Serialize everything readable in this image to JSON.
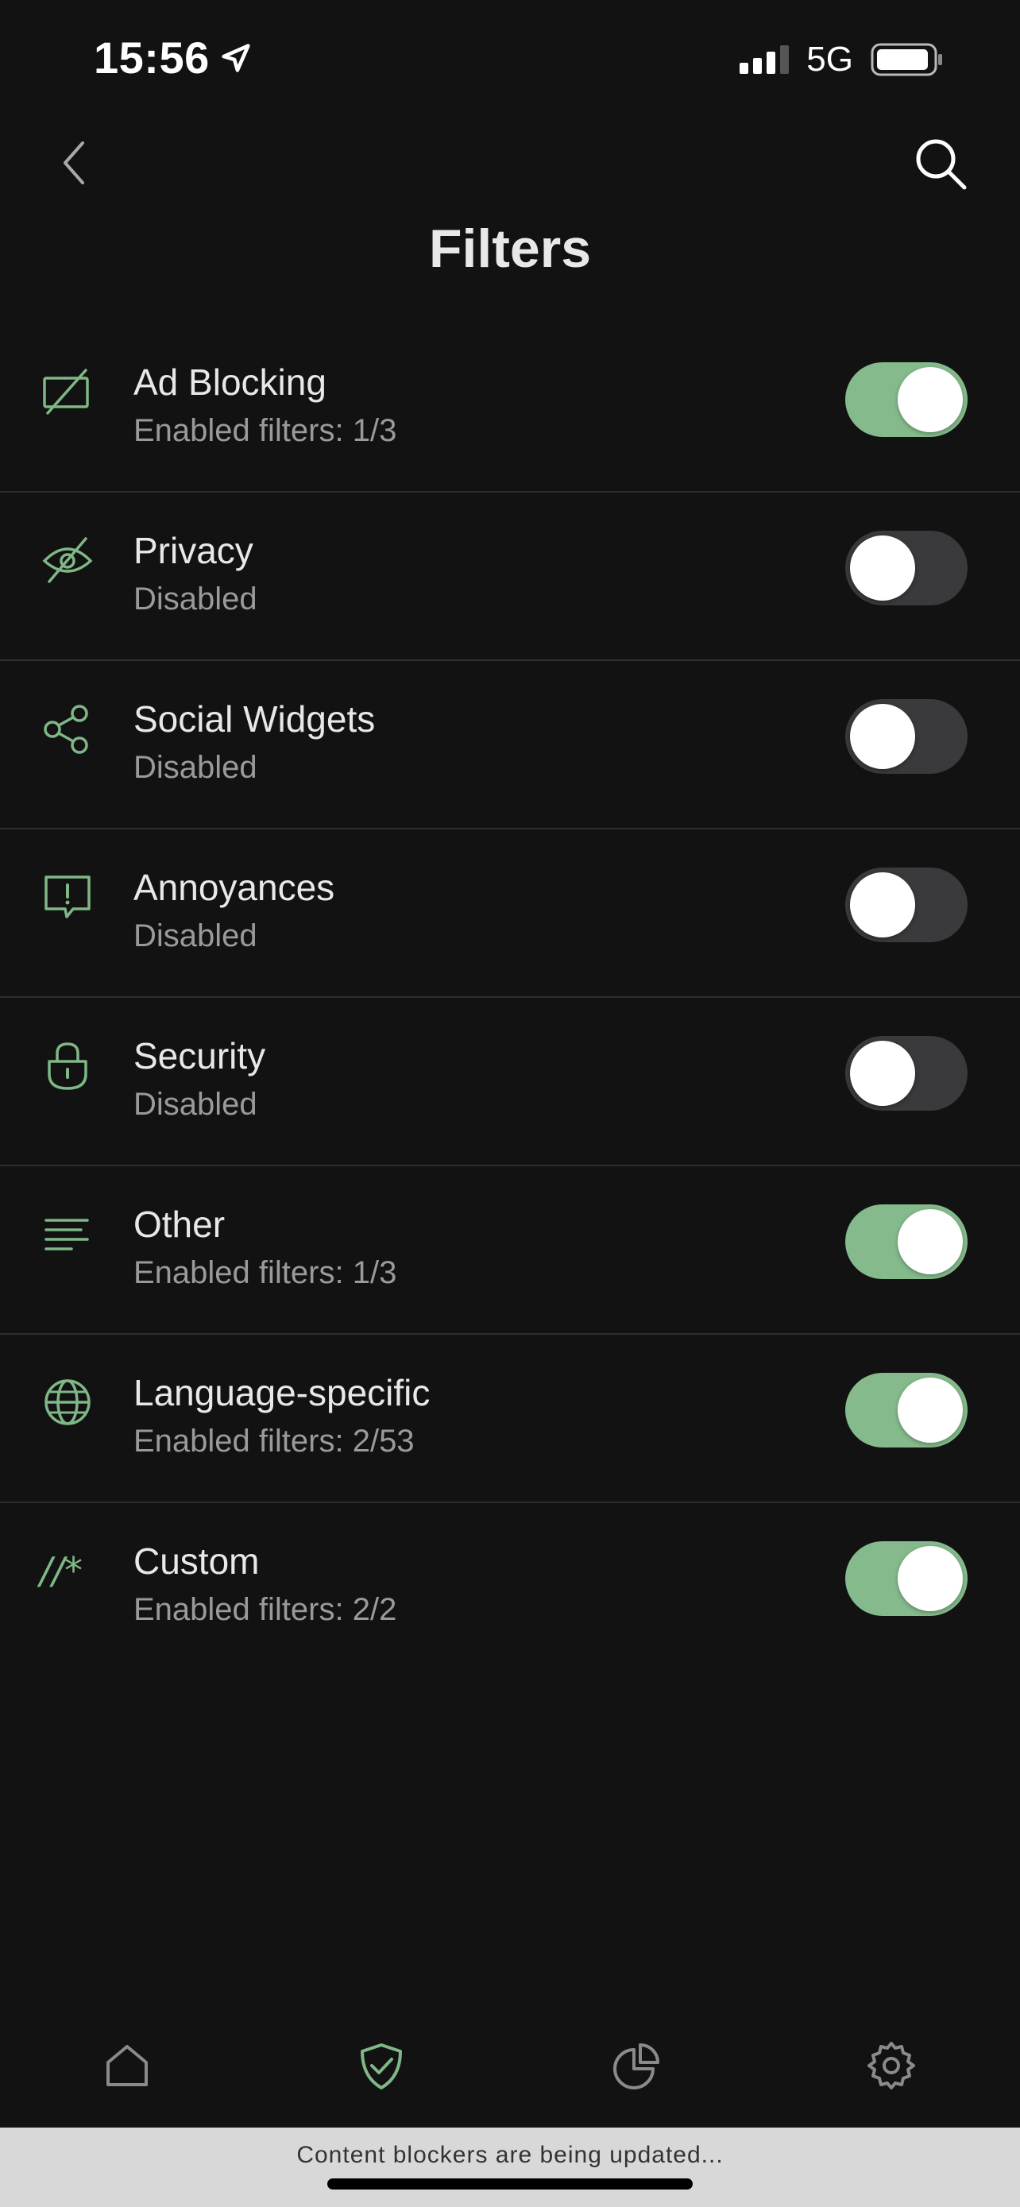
{
  "status_bar": {
    "time": "15:56",
    "network": "5G",
    "icons": [
      "location-arrow-icon",
      "signal-icon",
      "battery-icon"
    ]
  },
  "header": {
    "title": "Filters",
    "back_icon": "chevron-left-icon",
    "search_icon": "search-icon"
  },
  "accent_color": "#85bb8c",
  "icon_color": "#7fb786",
  "filters": [
    {
      "title": "Ad Blocking",
      "subtitle": "Enabled filters: 1/3",
      "enabled": true,
      "icon": "ad-block-icon"
    },
    {
      "title": "Privacy",
      "subtitle": "Disabled",
      "enabled": false,
      "icon": "eye-off-icon"
    },
    {
      "title": "Social Widgets",
      "subtitle": "Disabled",
      "enabled": false,
      "icon": "share-icon"
    },
    {
      "title": "Annoyances",
      "subtitle": "Disabled",
      "enabled": false,
      "icon": "alert-message-icon"
    },
    {
      "title": "Security",
      "subtitle": "Disabled",
      "enabled": false,
      "icon": "lock-icon"
    },
    {
      "title": "Other",
      "subtitle": "Enabled filters: 1/3",
      "enabled": true,
      "icon": "lines-icon"
    },
    {
      "title": "Language-specific",
      "subtitle": "Enabled filters: 2/53",
      "enabled": true,
      "icon": "globe-icon"
    },
    {
      "title": "Custom",
      "subtitle": "Enabled filters: 2/2",
      "enabled": true,
      "icon": "custom-rule-icon",
      "icon_text": "//*"
    }
  ],
  "tab_bar": {
    "tabs": [
      {
        "name": "home",
        "icon": "home-icon",
        "active": false
      },
      {
        "name": "protection",
        "icon": "shield-check-icon",
        "active": true
      },
      {
        "name": "statistics",
        "icon": "pie-chart-icon",
        "active": false
      },
      {
        "name": "settings",
        "icon": "gear-icon",
        "active": false
      }
    ]
  },
  "banner": {
    "text": "Content blockers are being updated..."
  }
}
